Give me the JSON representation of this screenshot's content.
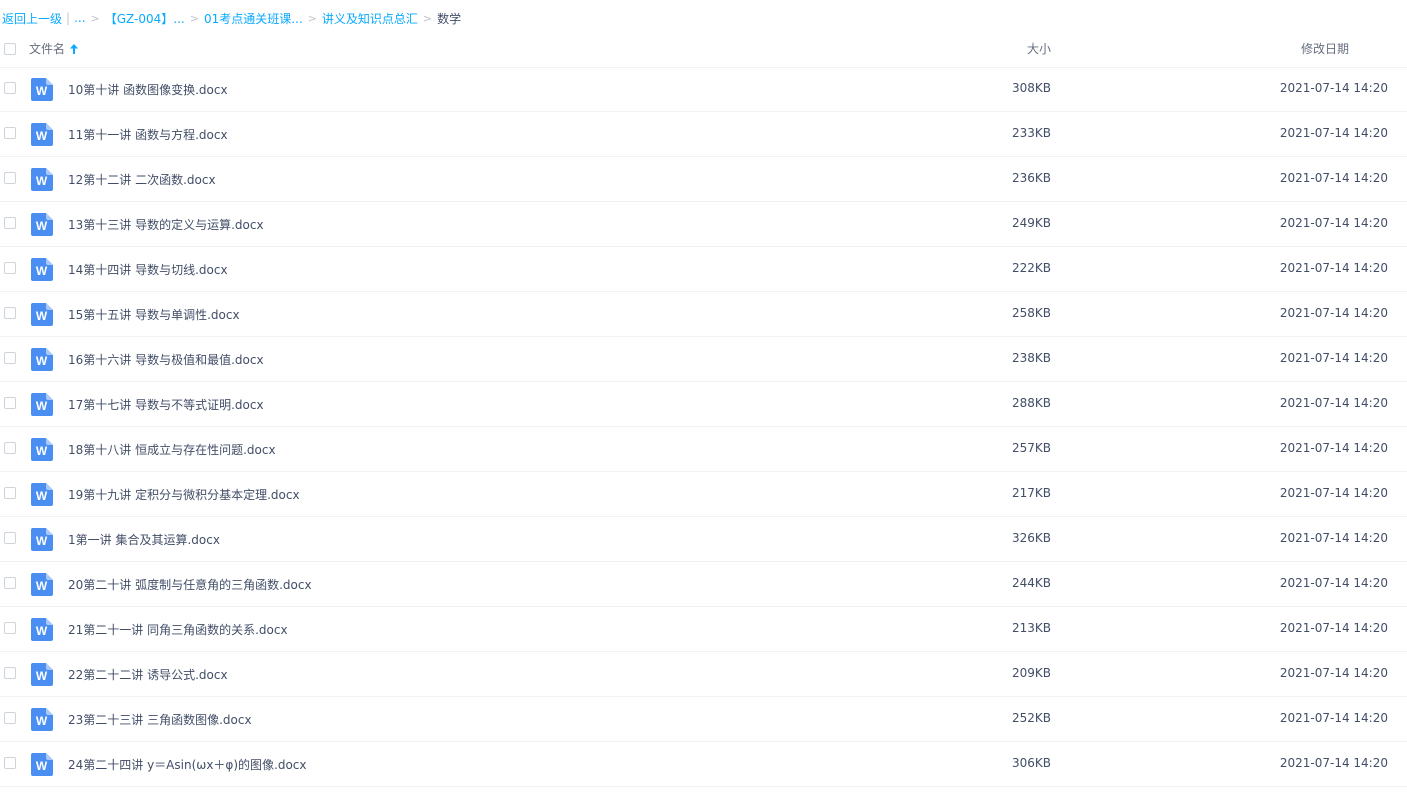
{
  "breadcrumb": {
    "back": "返回上一级",
    "ellipsis": "...",
    "items": [
      "【GZ-004】...",
      "01考点通关班课...",
      "讲义及知识点总汇"
    ],
    "current": "数学"
  },
  "header": {
    "name": "文件名",
    "size": "大小",
    "date": "修改日期"
  },
  "icon_names": {
    "file": "word-file-icon",
    "sort": "sort-ascending-icon"
  },
  "colors": {
    "link": "#09aaff",
    "word_icon": "#4a8ef2",
    "text": "#424e67"
  },
  "files": [
    {
      "name": "10第十讲 函数图像变换.docx",
      "size": "308KB",
      "date": "2021-07-14 14:20"
    },
    {
      "name": "11第十一讲 函数与方程.docx",
      "size": "233KB",
      "date": "2021-07-14 14:20"
    },
    {
      "name": "12第十二讲 二次函数.docx",
      "size": "236KB",
      "date": "2021-07-14 14:20"
    },
    {
      "name": "13第十三讲 导数的定义与运算.docx",
      "size": "249KB",
      "date": "2021-07-14 14:20"
    },
    {
      "name": "14第十四讲 导数与切线.docx",
      "size": "222KB",
      "date": "2021-07-14 14:20"
    },
    {
      "name": "15第十五讲 导数与单调性.docx",
      "size": "258KB",
      "date": "2021-07-14 14:20"
    },
    {
      "name": "16第十六讲 导数与极值和最值.docx",
      "size": "238KB",
      "date": "2021-07-14 14:20"
    },
    {
      "name": "17第十七讲 导数与不等式证明.docx",
      "size": "288KB",
      "date": "2021-07-14 14:20"
    },
    {
      "name": "18第十八讲 恒成立与存在性问题.docx",
      "size": "257KB",
      "date": "2021-07-14 14:20"
    },
    {
      "name": "19第十九讲 定积分与微积分基本定理.docx",
      "size": "217KB",
      "date": "2021-07-14 14:20"
    },
    {
      "name": "1第一讲 集合及其运算.docx",
      "size": "326KB",
      "date": "2021-07-14 14:20"
    },
    {
      "name": "20第二十讲 弧度制与任意角的三角函数.docx",
      "size": "244KB",
      "date": "2021-07-14 14:20"
    },
    {
      "name": "21第二十一讲 同角三角函数的关系.docx",
      "size": "213KB",
      "date": "2021-07-14 14:20"
    },
    {
      "name": "22第二十二讲 诱导公式.docx",
      "size": "209KB",
      "date": "2021-07-14 14:20"
    },
    {
      "name": "23第二十三讲 三角函数图像.docx",
      "size": "252KB",
      "date": "2021-07-14 14:20"
    },
    {
      "name": "24第二十四讲 y＝Asin(ωx＋φ)的图像.docx",
      "size": "306KB",
      "date": "2021-07-14 14:20"
    }
  ]
}
